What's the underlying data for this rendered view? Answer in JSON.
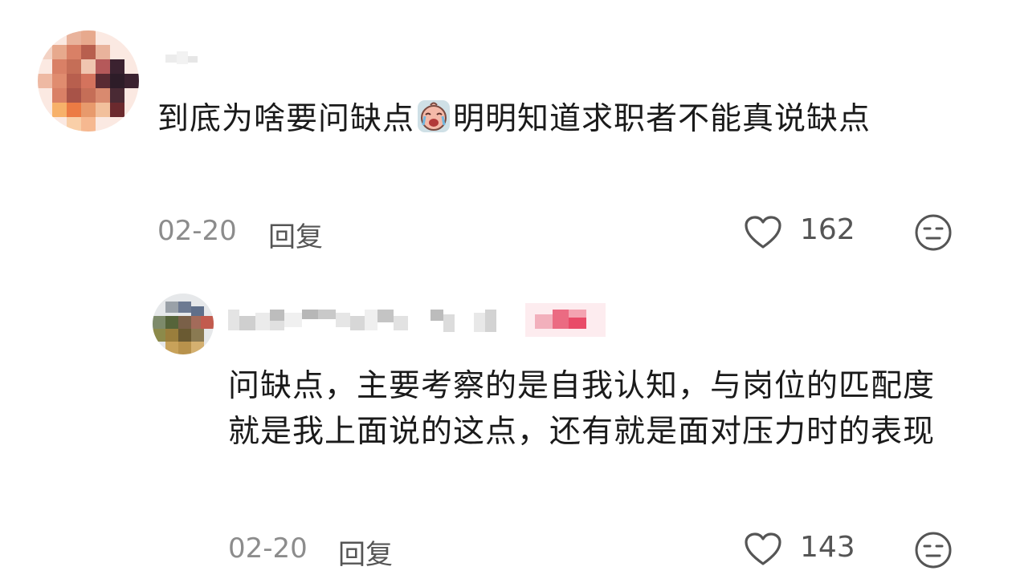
{
  "comments": [
    {
      "text_before_emoji": "到底为啥要问缺点",
      "text_after_emoji": "明明知道求职者不能真说缺点",
      "emoji": "crying-face-emoji",
      "date": "02-20",
      "reply_label": "回复",
      "like_count": "162",
      "colors": {
        "avatar_tones": [
          "#e7a98d",
          "#d98066",
          "#b85f4e",
          "#f0c5b0",
          "#3b2230",
          "#f7b16a",
          "#ec7b44"
        ]
      }
    },
    {
      "text": "问缺点，主要考察的是自我认知，与岗位的匹配度就是我上面说的这点，还有就是面对压力时的表现",
      "date": "02-20",
      "reply_label": "回复",
      "like_count": "143",
      "colors": {
        "avatar_tones": [
          "#5f6f8a",
          "#9aa1a8",
          "#56643a",
          "#c8a25a",
          "#d98a8e"
        ]
      }
    }
  ],
  "icons": {
    "like": "heart-outline-icon",
    "dislike": "neutral-face-icon"
  },
  "colors": {
    "text": "#1a1a1a",
    "meta": "#8c8c8c",
    "icon": "#555555",
    "badge_pink": "#e94b68"
  }
}
